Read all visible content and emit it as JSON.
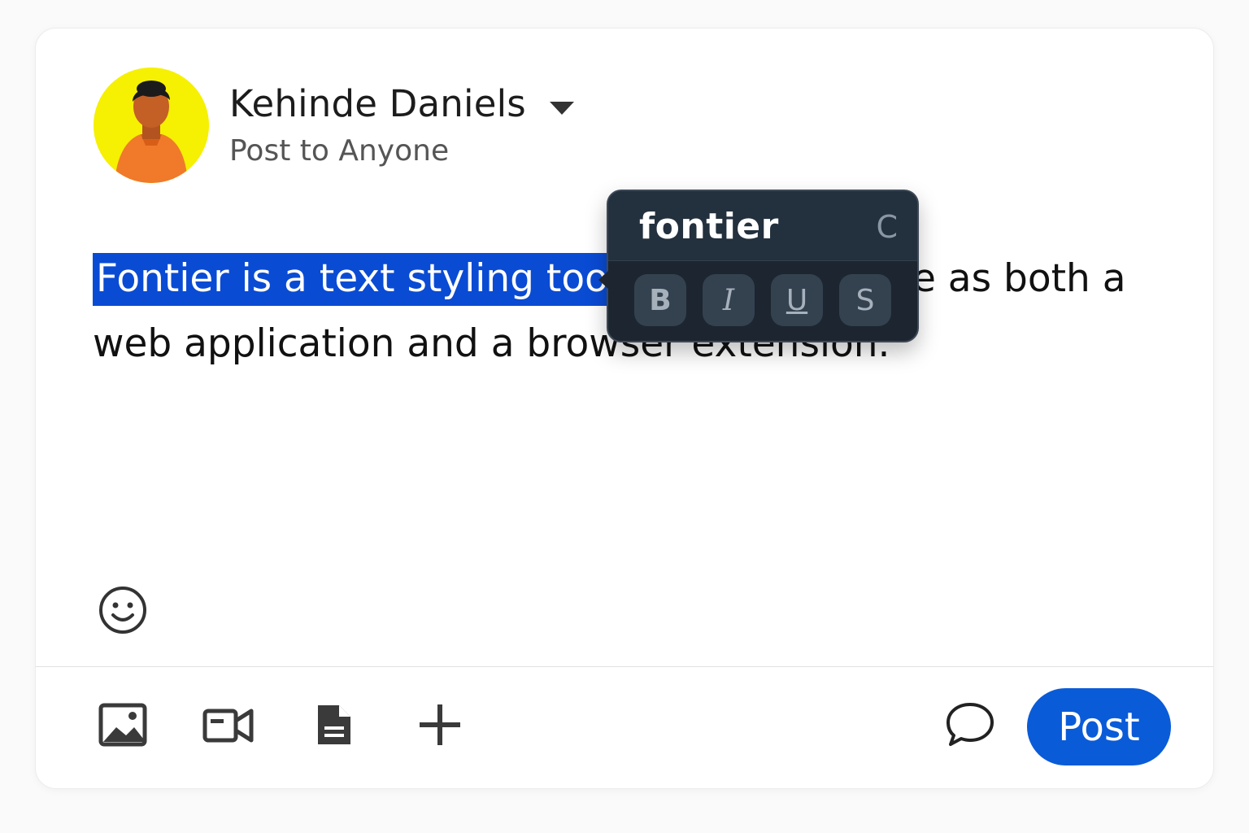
{
  "composer": {
    "user": {
      "name": "Kehinde Daniels",
      "audience": "Post to Anyone",
      "avatar_icon": "person-avatar-icon"
    },
    "body": {
      "selected_text": "Fontier is a text styling tool",
      "rest_text": " that is available as both a  web application and a browser extension."
    },
    "emoji_icon": "smiley-face-icon",
    "footer": {
      "tools": [
        {
          "name": "photo",
          "icon": "image-icon"
        },
        {
          "name": "video",
          "icon": "video-camera-icon"
        },
        {
          "name": "document",
          "icon": "document-icon"
        },
        {
          "name": "more",
          "icon": "plus-icon"
        }
      ],
      "comment_icon": "speech-bubble-icon",
      "post_label": "Post"
    }
  },
  "format_popup": {
    "brand": "fontier",
    "corner_label": "C",
    "buttons": [
      {
        "label": "B",
        "action": "bold"
      },
      {
        "label": "I",
        "action": "italic"
      },
      {
        "label": "U",
        "action": "underline"
      },
      {
        "label": "S",
        "action": "strikethrough"
      }
    ]
  },
  "colors": {
    "selection": "#0a4bd4",
    "post_button": "#0a5bd8",
    "popup_bg": "#1c2530",
    "avatar_bg": "#f6f003"
  }
}
